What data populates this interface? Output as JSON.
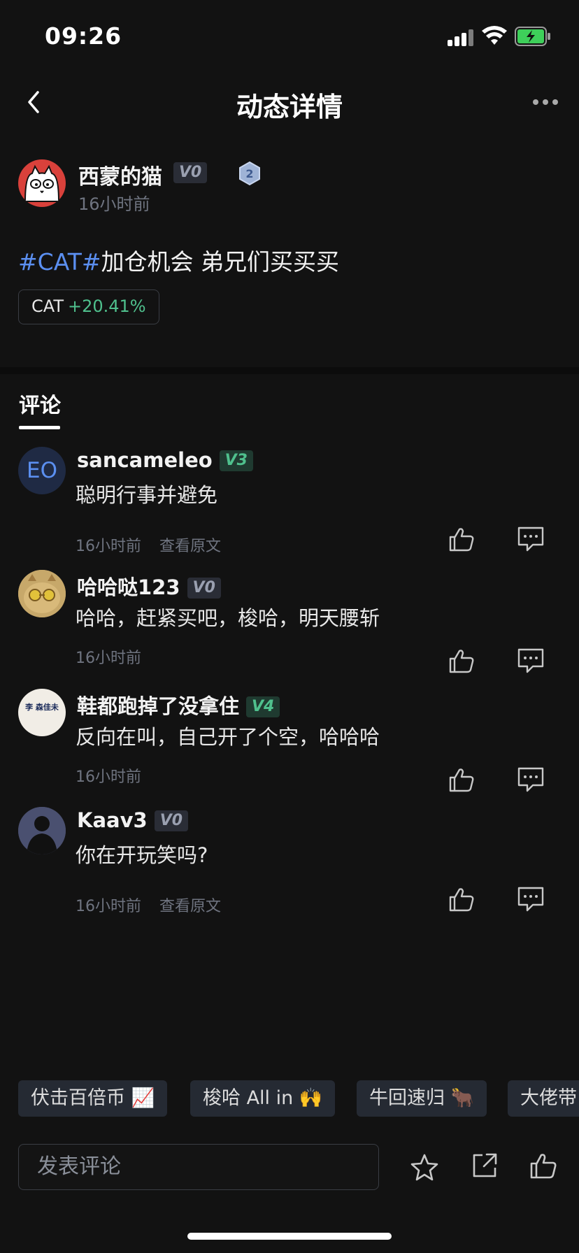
{
  "status_bar": {
    "time": "09:26"
  },
  "header": {
    "title": "动态详情",
    "back_icon": "chevron-left-icon",
    "more_icon": "more-dots-icon"
  },
  "post": {
    "author": "西蒙的猫",
    "level": "V0",
    "rank": "2",
    "time": "16小时前",
    "hashtag": "#CAT#",
    "content": "加仓机会 弟兄们买买买",
    "coin": {
      "symbol": "CAT",
      "change": "+20.41%"
    }
  },
  "tabs": {
    "comments": "评论"
  },
  "comments": [
    {
      "name": "sancameleo",
      "level": "V3",
      "avatar_text": "EO",
      "text": "聪明行事并避免",
      "time": "16小时前",
      "view_original": "查看原文"
    },
    {
      "name": "哈哈哒123",
      "level": "V0",
      "text": "哈哈，赶紧买吧，梭哈，明天腰斩",
      "time": "16小时前"
    },
    {
      "name": "鞋都跑掉了没拿住",
      "level": "V4",
      "avatar_text": "李 森佳未",
      "text": "反向在叫，自己开了个空，哈哈哈",
      "time": "16小时前"
    },
    {
      "name": "Kaav3",
      "level": "V0",
      "text": "你在开玩笑吗?",
      "time": "16小时前",
      "view_original": "查看原文"
    }
  ],
  "quick_replies": [
    "伏击百倍币 📈",
    "梭哈 All in 🙌",
    "牛回速归 🐂",
    "大佬带"
  ],
  "bottom_bar": {
    "placeholder": "发表评论",
    "icons": [
      "star-icon",
      "share-icon",
      "thumbs-up-icon"
    ]
  },
  "colors": {
    "background": "#121212",
    "accent_green": "#4fc08d",
    "hashtag_blue": "#5b8ff0"
  }
}
